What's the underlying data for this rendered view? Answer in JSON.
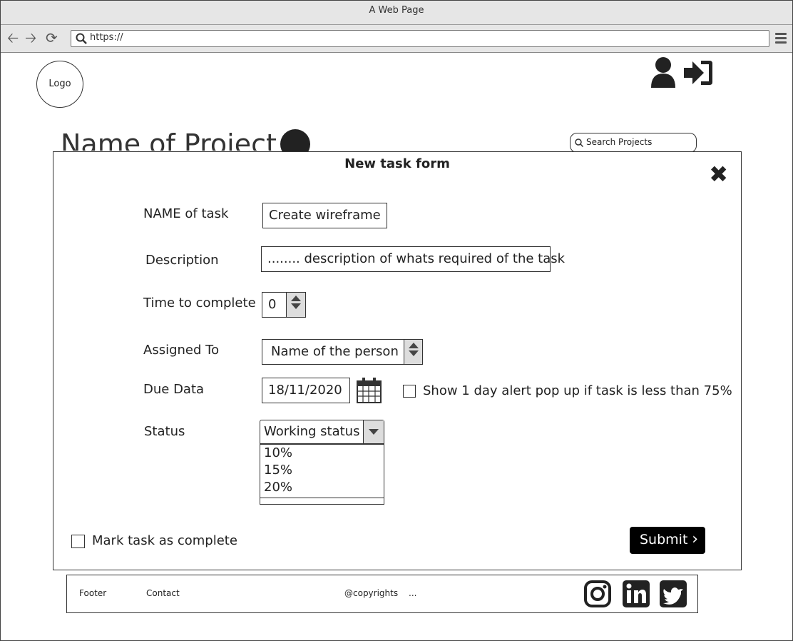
{
  "browser": {
    "title": "A Web Page",
    "url": "https://",
    "back_icon": "back-arrow-icon",
    "forward_icon": "forward-arrow-icon",
    "reload_icon": "reload-icon",
    "menu_icon": "hamburger-menu-icon"
  },
  "header": {
    "logo": "Logo",
    "user_icon": "user-icon",
    "login_icon": "sign-in-icon"
  },
  "page": {
    "project_title": "Name of Project",
    "search_placeholder": "Search Projects"
  },
  "modal": {
    "title": "New task form",
    "close_icon": "close-icon",
    "name_label": "NAME of task",
    "name_value": "Create wireframe",
    "description_label": "Description",
    "description_value": "........ description of whats required of the task",
    "time_label": "Time to complete",
    "time_value": "0",
    "assigned_label": "Assigned To",
    "assigned_value": "Name of the person",
    "due_label": "Due Data",
    "due_value": "18/11/2020",
    "alert_label": "Show 1 day alert pop up if task is less than 75%",
    "status_label": "Status",
    "status_value": "Working status",
    "status_options": [
      "10%",
      "15%",
      "20%"
    ],
    "complete_label": "Mark task as complete",
    "submit_label": "Submit"
  },
  "footer": {
    "footer_label": "Footer",
    "contact_label": "Contact",
    "copyright": "@copyrights",
    "ellipsis": "...",
    "social_icons": [
      "instagram-icon",
      "linkedin-icon",
      "twitter-icon"
    ]
  }
}
